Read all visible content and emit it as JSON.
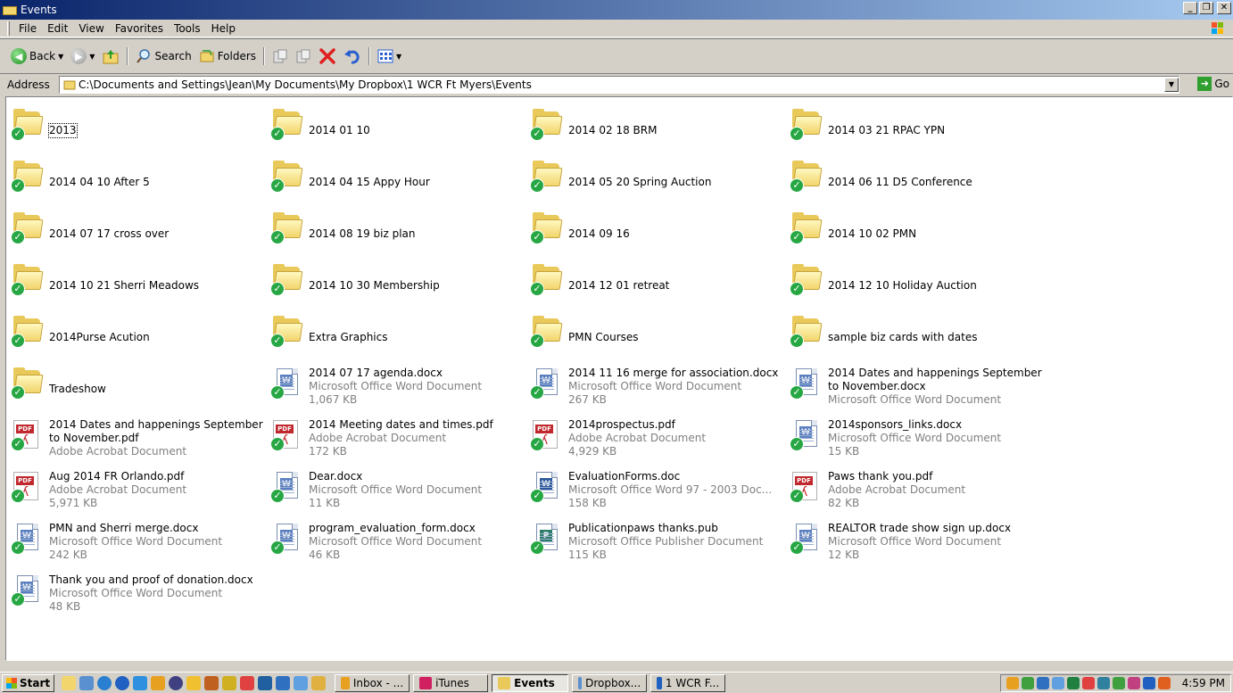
{
  "window": {
    "title": "Events"
  },
  "menu": [
    "File",
    "Edit",
    "View",
    "Favorites",
    "Tools",
    "Help"
  ],
  "toolbar": {
    "back": "Back",
    "search": "Search",
    "folders": "Folders"
  },
  "address": {
    "label": "Address",
    "value": "C:\\Documents and Settings\\Jean\\My Documents\\My Dropbox\\1 WCR Ft Myers\\Events",
    "go": "Go"
  },
  "items": [
    {
      "name": "2013",
      "type": "folder",
      "selected": true
    },
    {
      "name": "2014 01 10",
      "type": "folder"
    },
    {
      "name": "2014 02 18 BRM",
      "type": "folder"
    },
    {
      "name": "2014 03 21 RPAC YPN",
      "type": "folder"
    },
    {
      "name": "2014 04 10 After 5",
      "type": "folder"
    },
    {
      "name": "2014 04 15 Appy Hour",
      "type": "folder"
    },
    {
      "name": "2014 05 20 Spring Auction",
      "type": "folder"
    },
    {
      "name": "2014 06 11 D5 Conference",
      "type": "folder"
    },
    {
      "name": "2014 07 17 cross over",
      "type": "folder"
    },
    {
      "name": "2014 08 19 biz plan",
      "type": "folder"
    },
    {
      "name": "2014 09 16",
      "type": "folder"
    },
    {
      "name": "2014 10 02 PMN",
      "type": "folder"
    },
    {
      "name": "2014 10 21 Sherri Meadows",
      "type": "folder"
    },
    {
      "name": "2014 10 30 Membership",
      "type": "folder"
    },
    {
      "name": "2014 12 01 retreat",
      "type": "folder"
    },
    {
      "name": "2014 12 10 Holiday Auction",
      "type": "folder"
    },
    {
      "name": "2014Purse Acution",
      "type": "folder"
    },
    {
      "name": "Extra Graphics",
      "type": "folder"
    },
    {
      "name": "PMN Courses",
      "type": "folder"
    },
    {
      "name": "sample biz cards with dates",
      "type": "folder"
    },
    {
      "name": "Tradeshow",
      "type": "folder"
    },
    {
      "name": "2014 07 17 agenda.docx",
      "type": "docx",
      "kind": "Microsoft Office Word Document",
      "size": "1,067 KB"
    },
    {
      "name": "2014 11 16 merge for association.docx",
      "type": "docx",
      "kind": "Microsoft Office Word Document",
      "size": "267 KB"
    },
    {
      "name": "2014 Dates and happenings September to November.docx",
      "type": "docx",
      "kind": "Microsoft Office Word Document",
      "size": ""
    },
    {
      "name": "2014 Dates and happenings September to November.pdf",
      "type": "pdf",
      "kind": "Adobe Acrobat Document",
      "size": ""
    },
    {
      "name": "2014 Meeting dates and times.pdf",
      "type": "pdf",
      "kind": "Adobe Acrobat Document",
      "size": "172 KB"
    },
    {
      "name": "2014prospectus.pdf",
      "type": "pdf",
      "kind": "Adobe Acrobat Document",
      "size": "4,929 KB"
    },
    {
      "name": "2014sponsors_links.docx",
      "type": "docx",
      "kind": "Microsoft Office Word Document",
      "size": "15 KB"
    },
    {
      "name": "Aug 2014 FR Orlando.pdf",
      "type": "pdf",
      "kind": "Adobe Acrobat Document",
      "size": "5,971 KB"
    },
    {
      "name": "Dear.docx",
      "type": "docx",
      "kind": "Microsoft Office Word Document",
      "size": "11 KB"
    },
    {
      "name": "EvaluationForms.doc",
      "type": "doc",
      "kind": "Microsoft Office Word 97 - 2003 Doc...",
      "size": "158 KB"
    },
    {
      "name": "Paws thank you.pdf",
      "type": "pdf",
      "kind": "Adobe Acrobat Document",
      "size": "82 KB"
    },
    {
      "name": "PMN and Sherri merge.docx",
      "type": "docx",
      "kind": "Microsoft Office Word Document",
      "size": "242 KB"
    },
    {
      "name": "program_evaluation_form.docx",
      "type": "docx",
      "kind": "Microsoft Office Word Document",
      "size": "46 KB"
    },
    {
      "name": "Publicationpaws thanks.pub",
      "type": "pub",
      "kind": "Microsoft Office Publisher Document",
      "size": "115 KB"
    },
    {
      "name": "REALTOR trade show sign up.docx",
      "type": "docx",
      "kind": "Microsoft Office Word Document",
      "size": "12 KB"
    },
    {
      "name": "Thank you and proof of donation.docx",
      "type": "docx",
      "kind": "Microsoft Office Word Document",
      "size": "48 KB"
    }
  ],
  "taskbar": {
    "start": "Start",
    "tasks": [
      {
        "label": "Inbox - ...",
        "color": "#e8a020"
      },
      {
        "label": "iTunes",
        "color": "#d02060"
      },
      {
        "label": "Events",
        "color": "#e8c95a",
        "active": true
      },
      {
        "label": "Dropbox...",
        "color": "#5a8fd0"
      },
      {
        "label": "1 WCR F...",
        "color": "#2060c0"
      }
    ],
    "clock": "4:59 PM"
  }
}
